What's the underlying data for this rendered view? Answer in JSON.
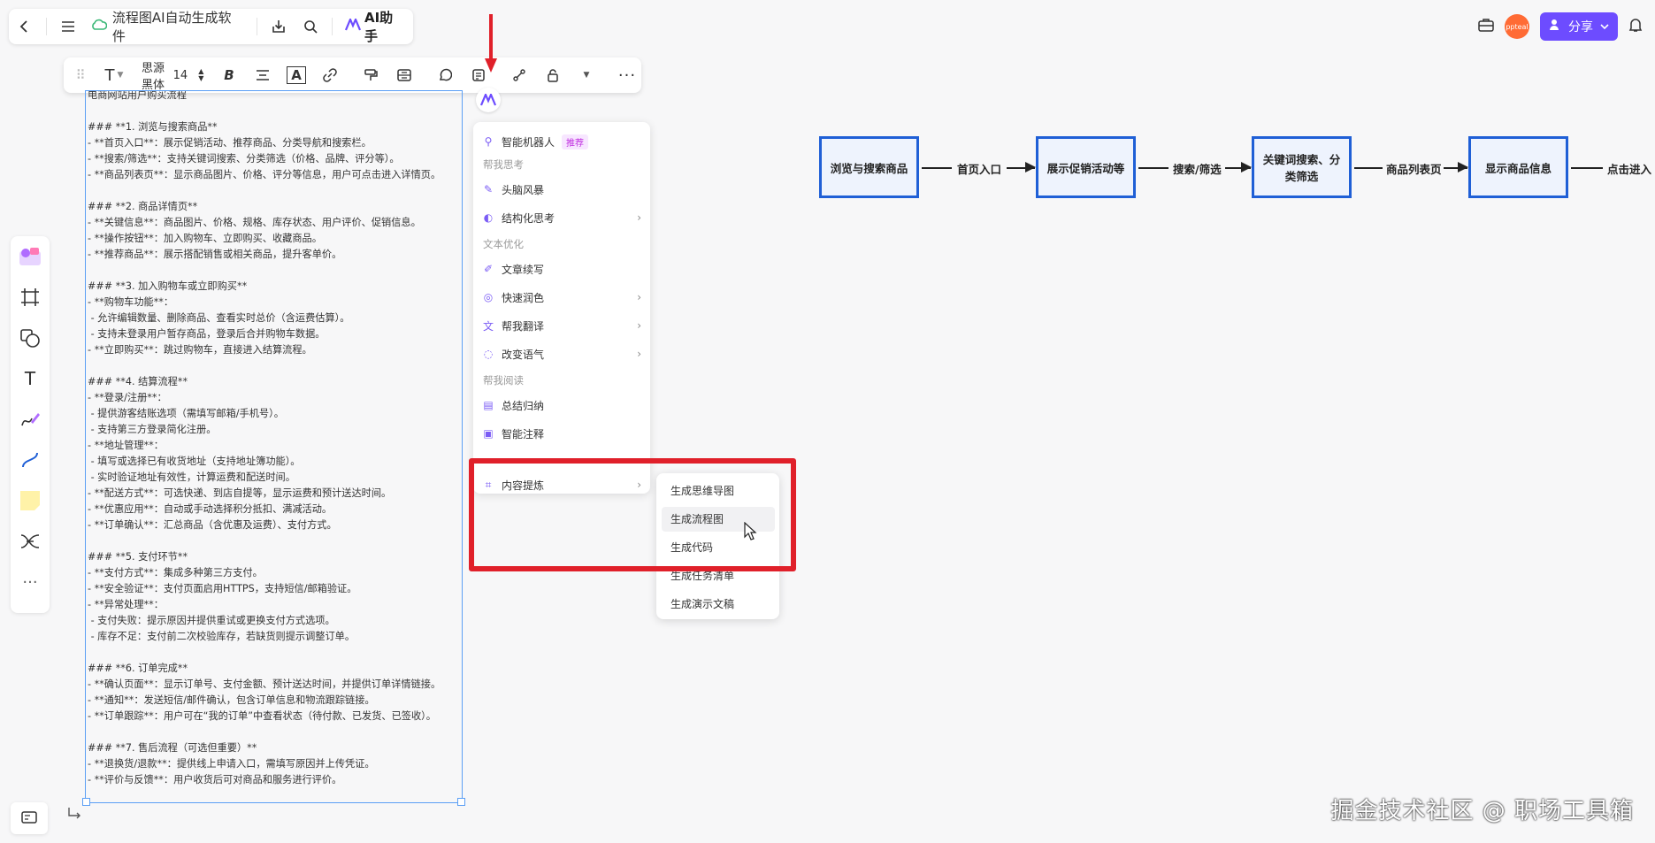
{
  "topbar": {
    "doc_title": "流程图AI自动生成软件",
    "ai_assistant": "AI助手",
    "share_label": "分享",
    "avatar_text": "ppteal"
  },
  "format_bar": {
    "font_name": "思源黑体",
    "font_size": "14"
  },
  "text_card": {
    "content": "电商网站用户购买流程\n\n### **1. 浏览与搜索商品**\n- **首页入口**：展示促销活动、推荐商品、分类导航和搜索栏。\n- **搜索/筛选**：支持关键词搜索、分类筛选（价格、品牌、评分等）。\n- **商品列表页**：显示商品图片、价格、评分等信息，用户可点击进入详情页。\n\n### **2. 商品详情页**\n- **关键信息**：商品图片、价格、规格、库存状态、用户评价、促销信息。\n- **操作按钮**：加入购物车、立即购买、收藏商品。\n- **推荐商品**：展示搭配销售或相关商品，提升客单价。\n\n### **3. 加入购物车或立即购买**\n- **购物车功能**：\n - 允许编辑数量、删除商品、查看实时总价（含运费估算）。\n - 支持未登录用户暂存商品，登录后合并购物车数据。\n- **立即购买**：跳过购物车，直接进入结算流程。\n\n### **4. 结算流程**\n- **登录/注册**：\n - 提供游客结账选项（需填写邮箱/手机号）。\n - 支持第三方登录简化注册。\n- **地址管理**：\n - 填写或选择已有收货地址（支持地址簿功能）。\n - 实时验证地址有效性，计算运费和配送时间。\n- **配送方式**：可选快递、到店自提等，显示运费和预计送达时间。\n- **优惠应用**：自动或手动选择积分抵扣、满减活动。\n- **订单确认**：汇总商品（含优惠及运费）、支付方式。\n\n### **5. 支付环节**\n- **支付方式**：集成多种第三方支付。\n- **安全验证**：支付页面启用HTTPS，支持短信/邮箱验证。\n- **异常处理**：\n - 支付失败：提示原因并提供重试或更换支付方式选项。\n - 库存不足：支付前二次校验库存，若缺货则提示调整订单。\n\n### **6. 订单完成**\n- **确认页面**：显示订单号、支付金额、预计送达时间，并提供订单详情链接。\n- **通知**：发送短信/邮件确认，包含订单信息和物流跟踪链接。\n- **订单跟踪**：用户可在“我的订单”中查看状态（待付款、已发货、已签收）。\n\n### **7. 售后流程（可选但重要）**\n- **退换货/退款**：提供线上申请入口，需填写原因并上传凭证。\n- **评价与反馈**：用户收货后可对商品和服务进行评价。"
  },
  "ai_menu": {
    "robot": "智能机器人",
    "robot_tag": "推荐",
    "section_think": "帮我思考",
    "brainstorm": "头脑风暴",
    "structured": "结构化思考",
    "section_optimize": "文本优化",
    "continue": "文章续写",
    "polish": "快速润色",
    "translate": "帮我翻译",
    "tone": "改变语气",
    "section_read": "帮我阅读",
    "summary": "总结归纳",
    "annotate": "智能注释",
    "extract": "内容提炼"
  },
  "sub_menu": {
    "items": [
      "生成思维导图",
      "生成流程图",
      "生成代码",
      "生成任务清单",
      "生成演示文稿"
    ]
  },
  "flowchart": {
    "nodes": [
      "浏览与搜索商品",
      "展示促销活动等",
      "关键词搜索、分类筛选",
      "显示商品信息"
    ],
    "edges": [
      "首页入口",
      "搜索/筛选",
      "商品列表页",
      "点击进入"
    ]
  },
  "watermark": "掘金技术社区 @ 职场工具箱",
  "colors": {
    "accent": "#6d4cff",
    "flow_border": "#1f5fd6",
    "highlight_red": "#e0202a",
    "selection_blue": "#5b9ff5"
  }
}
